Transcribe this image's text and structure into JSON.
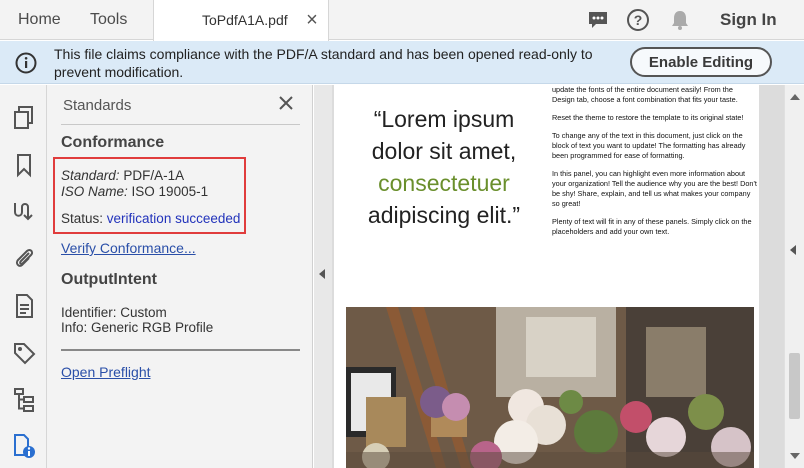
{
  "topbar": {
    "home": "Home",
    "tools": "Tools",
    "doc_tab": "ToPdfA1A.pdf",
    "close_glyph": "×",
    "sign_in": "Sign In",
    "icons": [
      "comment-icon",
      "help-icon",
      "bell-icon"
    ]
  },
  "banner": {
    "message": "This file claims compliance with the PDF/A standard and has been opened read-only to prevent modification.",
    "button": "Enable Editing",
    "background": "#dbeaf7"
  },
  "rail": {
    "icons": [
      "pages-icon",
      "bookmark-icon",
      "signature-icon",
      "attachment-icon",
      "document-properties-icon",
      "tag-icon",
      "content-tree-icon",
      "standards-icon"
    ]
  },
  "standards_panel": {
    "title": "Standards",
    "conformance_heading": "Conformance",
    "standard_label": "Standard:",
    "standard_value": "PDF/A-1A",
    "iso_label": "ISO Name:",
    "iso_value": "ISO 19005-1",
    "status_label": "Status:",
    "status_value": "verification succeeded",
    "verify_link": "Verify Conformance...",
    "outputintent_heading": "OutputIntent",
    "identifier": "Identifier: Custom",
    "info": "Info: Generic RGB Profile",
    "preflight_link": "Open Preflight",
    "highlight_color": "#e03c3c"
  },
  "document": {
    "quote_line1": "“Lorem ipsum",
    "quote_line2": "dolor sit amet,",
    "quote_line3": "consectetuer",
    "quote_line4": "adipiscing elit.”",
    "accent_color": "#6a8f2c",
    "para1": "update the fonts of the entire document easily! From the Design tab, choose a font combination that fits your taste.",
    "para2": "Reset the theme to restore the template to its original state!",
    "para3": "To change any of the text in this document, just click on the block of text you want to update! The formatting has already been programmed for ease of formatting.",
    "para4": "In this panel, you can highlight even more information about your organization! Tell the audience why you are the best! Don't be shy! Share, explain, and tell us what makes your company so great!",
    "para5": "Plenty of text will fit in any of these panels. Simply click on the placeholders and add your own text."
  }
}
